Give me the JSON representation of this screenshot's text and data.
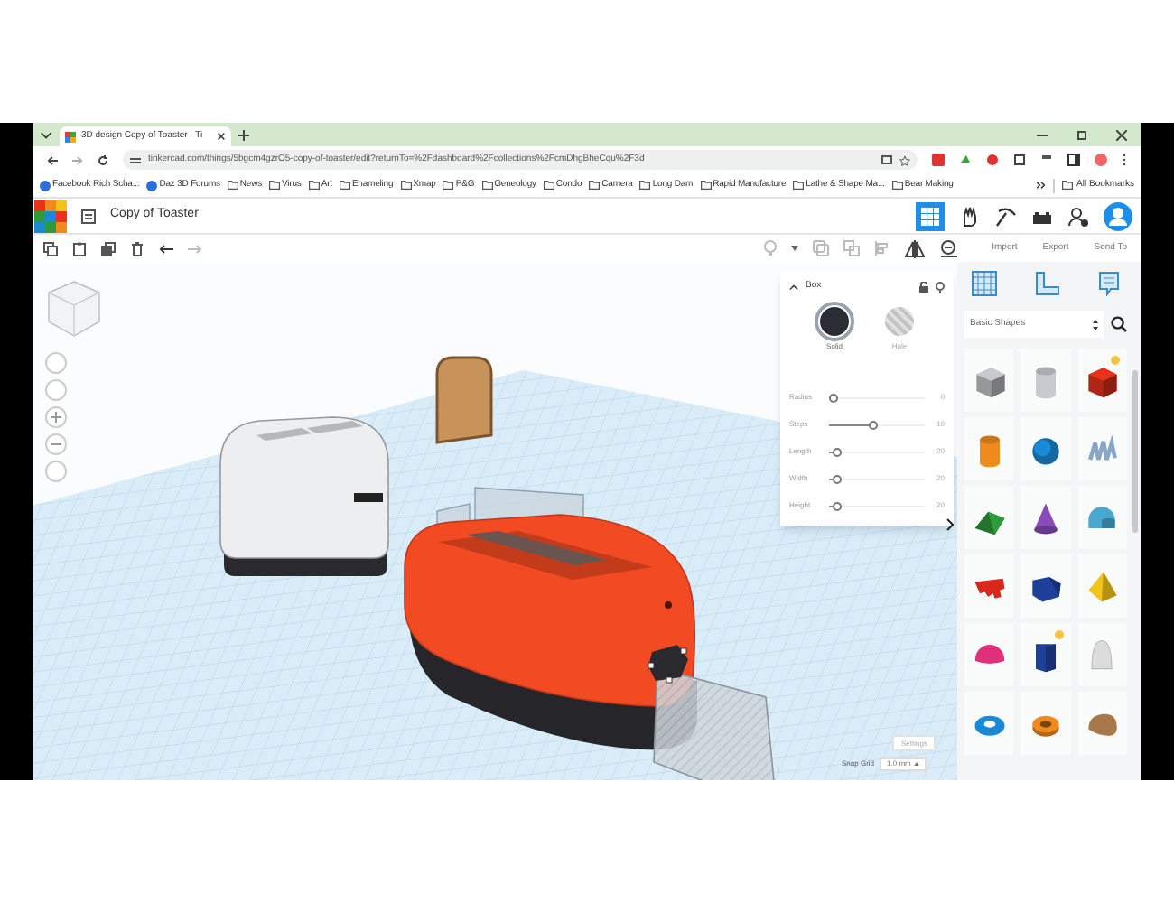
{
  "browser": {
    "tab": {
      "title": "3D design Copy of Toaster - Ti"
    },
    "address": "tinkercad.com/things/5bgcm4gzrO5-copy-of-toaster/edit?returnTo=%2Fdashboard%2Fcollections%2FcmDhgBheCqu%2F3d",
    "bookmarks": [
      {
        "label": "Facebook Rich Scha...",
        "kind": "site"
      },
      {
        "label": "Daz 3D Forums",
        "kind": "site"
      },
      {
        "label": "News",
        "kind": "folder"
      },
      {
        "label": "Virus",
        "kind": "folder"
      },
      {
        "label": "Art",
        "kind": "folder"
      },
      {
        "label": "Enameling",
        "kind": "folder"
      },
      {
        "label": "Xmap",
        "kind": "folder"
      },
      {
        "label": "P&G",
        "kind": "folder"
      },
      {
        "label": "Geneology",
        "kind": "folder"
      },
      {
        "label": "Condo",
        "kind": "folder"
      },
      {
        "label": "Camera",
        "kind": "folder"
      },
      {
        "label": "Long Dam",
        "kind": "folder"
      },
      {
        "label": "Rapid Manufacture",
        "kind": "folder"
      },
      {
        "label": "Lathe & Shape Ma...",
        "kind": "folder"
      },
      {
        "label": "Bear Making",
        "kind": "folder"
      }
    ],
    "all_bookmarks": "All Bookmarks"
  },
  "app": {
    "design_title": "Copy of Toaster",
    "actions": [
      "Import",
      "Export",
      "Send To"
    ]
  },
  "inspector": {
    "title": "Box",
    "modes": [
      {
        "label": "Solid",
        "selected": true
      },
      {
        "label": "Hole",
        "selected": false
      }
    ],
    "params": [
      {
        "label": "Radius",
        "level": 0,
        "reading": "0"
      },
      {
        "label": "Steps",
        "level": 0.45,
        "reading": "10"
      },
      {
        "label": "Length",
        "level": 0.05,
        "reading": "20"
      },
      {
        "label": "Width",
        "level": 0.05,
        "reading": "20"
      },
      {
        "label": "Height",
        "level": 0.05,
        "reading": "20"
      }
    ]
  },
  "library": {
    "category": "Basic Shapes",
    "shapes": [
      {
        "kind": "box",
        "color": "#c9cacf",
        "new": false
      },
      {
        "kind": "cylinder",
        "color": "#c9cacf",
        "new": false
      },
      {
        "kind": "box",
        "color": "#e8321c",
        "new": true
      },
      {
        "kind": "cylinder",
        "color": "#f08a1c",
        "new": false
      },
      {
        "kind": "sphere",
        "color": "#1a8ad6",
        "new": false
      },
      {
        "kind": "scribble",
        "color": "#8aa6c6",
        "new": false
      },
      {
        "kind": "roof",
        "color": "#2e9a3a",
        "new": false
      },
      {
        "kind": "cone",
        "color": "#8a4bb8",
        "new": false
      },
      {
        "kind": "round-roof",
        "color": "#4aa8d0",
        "new": false
      },
      {
        "kind": "text",
        "color": "#d8281c",
        "new": false
      },
      {
        "kind": "polygon",
        "color": "#1e3f9a",
        "new": false
      },
      {
        "kind": "pyramid",
        "color": "#f2c318",
        "new": false
      },
      {
        "kind": "half-sphere",
        "color": "#e0307a",
        "new": false
      },
      {
        "kind": "prism",
        "color": "#1e3f9a",
        "new": true
      },
      {
        "kind": "paraboloid",
        "color": "#dcdcdc",
        "new": false
      },
      {
        "kind": "torus",
        "color": "#1a8ad6",
        "new": false
      },
      {
        "kind": "tube",
        "color": "#f08a1c",
        "new": false
      },
      {
        "kind": "blob",
        "color": "#a8784a",
        "new": false
      }
    ]
  },
  "snap": {
    "settings": "Settings",
    "label": "Snap Grid",
    "value": "1.0 mm"
  }
}
